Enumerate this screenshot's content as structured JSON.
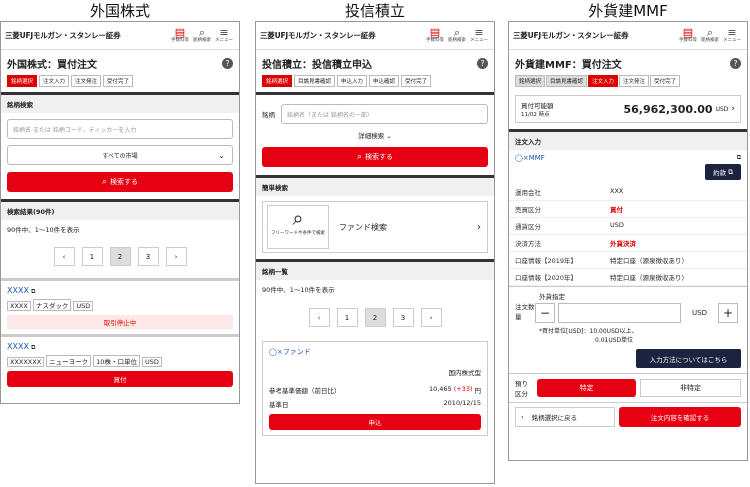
{
  "titles": {
    "c1": "外国株式",
    "c2": "投信積立",
    "c3": "外貨建MMF"
  },
  "brand": "三菱UFJモルガン・スタンレー証券",
  "header_icons": {
    "risk": "手数料等",
    "search": "銘柄検索",
    "menu": "メニュー",
    "risk_top": "リスク"
  },
  "p1": {
    "page_title": "外国株式：買付注文",
    "steps": [
      "銘柄選択",
      "注文入力",
      "注文発注",
      "受付完了"
    ],
    "sec_search": "銘柄検索",
    "search_placeholder": "銘柄名 または 銘柄コード、ティッカーを入力",
    "market": "すべての市場",
    "search_btn": "検索する",
    "results_head": "検索結果(90件)",
    "count": "90件中、1〜10件を表示",
    "pages": [
      "1",
      "2",
      "3"
    ],
    "item1": {
      "name": "XXXX",
      "tags": [
        "XXXX",
        "ナスダック",
        "USD"
      ],
      "status": "取引停止中"
    },
    "item2": {
      "name": "XXXX",
      "tags": [
        "XXXXXXX",
        "ニューヨーク",
        "10株・口単位",
        "USD"
      ],
      "btn": "買付"
    }
  },
  "p2": {
    "page_title": "投信積立：投信積立申込",
    "steps": [
      "銘柄選択",
      "目論見書確認",
      "申込入力",
      "申込確認",
      "受付完了"
    ],
    "label": "銘柄",
    "placeholder": "銘柄名（または 銘柄名の一部）",
    "detail": "詳細検索",
    "search_btn": "検索する",
    "sec_simple": "簡単検索",
    "free_word": "フリーワードや条件で検索",
    "fund_search": "ファンド検索",
    "sec_list": "銘柄一覧",
    "count": "90件中、1〜10件を表示",
    "pages": [
      "1",
      "2",
      "3"
    ],
    "fund_name": "◯×ファンド",
    "fund_type": "国内株式型",
    "nav_label": "参考基準価額（前日比）",
    "nav_value": "10,465",
    "nav_change": "(+33)",
    "nav_unit": "円",
    "date_label": "基準日",
    "date_value": "2010/12/15",
    "apply": "申込"
  },
  "p3": {
    "page_title": "外貨建MMF：買付注文",
    "steps": [
      "銘柄選択",
      "目論見書確認",
      "注文入力",
      "注文発注",
      "受付完了"
    ],
    "avail_label": "買付可能額",
    "avail_date": "11/02 時点",
    "avail_value": "56,962,300.00",
    "avail_unit": "USD",
    "sec_order": "注文入力",
    "fund_name": "◯×MMF",
    "yakkan": "約款",
    "rows": [
      {
        "k": "運用会社",
        "v": "XXX",
        "red": false
      },
      {
        "k": "売買区分",
        "v": "買付",
        "red": true
      },
      {
        "k": "通貨区分",
        "v": "USD",
        "red": false
      },
      {
        "k": "決済方法",
        "v": "外貨決済",
        "red": true
      },
      {
        "k": "口座情報【2019年】",
        "v": "特定口座（源泉徴収あり）",
        "red": false
      },
      {
        "k": "口座情報【2020年】",
        "v": "特定口座（源泉徴収あり）",
        "red": false
      }
    ],
    "qty_label": "注文数量",
    "qty_sub": "外貨指定",
    "qty_unit": "USD",
    "note1": "*買付単位[USD]：10.00USD以上、",
    "note2": "0.01USD単位",
    "how_btn": "入力方法についてはこちら",
    "deposit_label": "預り区分",
    "tokutei": "特定",
    "non_tokutei": "非特定",
    "back": "銘柄選択に戻る",
    "confirm": "注文内容を確認する"
  }
}
